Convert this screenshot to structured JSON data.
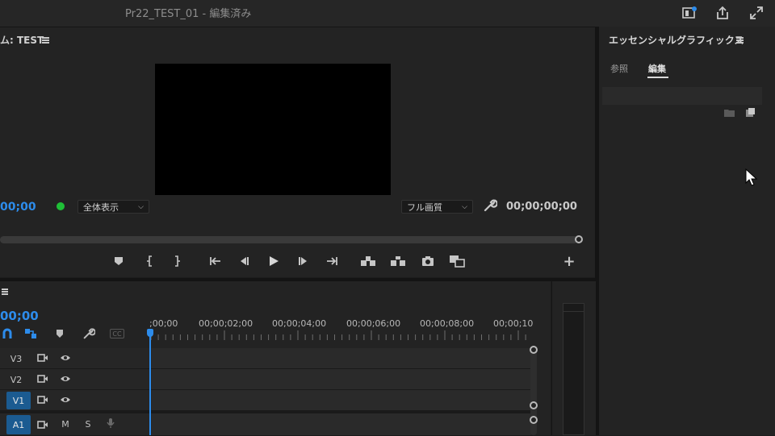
{
  "window": {
    "title": "Pr22_TEST_01 - 編集済み"
  },
  "top_icons": [
    "quick-export-icon",
    "share-icon",
    "maximize-icon"
  ],
  "program_monitor": {
    "title": "ム: TEST",
    "timecode_current": "00;00",
    "zoom_dropdown": "全体表示",
    "quality_dropdown": "フル画質",
    "timecode_duration": "00;00;00;00",
    "controls": [
      "add-marker",
      "mark-in",
      "mark-out",
      "go-to-in",
      "step-back",
      "play",
      "step-forward",
      "go-to-out",
      "lift",
      "extract",
      "export-frame",
      "comparison-view",
      "add-button"
    ],
    "status_color": "#1fbf37"
  },
  "timeline": {
    "timecode": "00;00",
    "ruler_labels": [
      ";00;00",
      "00;00;02;00",
      "00;00;04;00",
      "00;00;06;00",
      "00;00;08;00",
      "00;00;10"
    ],
    "tracks": [
      {
        "name": "V3",
        "active": false,
        "kind": "video"
      },
      {
        "name": "V2",
        "active": false,
        "kind": "video"
      },
      {
        "name": "V1",
        "active": true,
        "kind": "video"
      },
      {
        "name": "A1",
        "active": true,
        "kind": "audio",
        "mute": "M",
        "solo": "S"
      }
    ],
    "tools_label_cc": "CC",
    "accent_color": "#2d8ceb"
  },
  "essential_graphics": {
    "title": "エッセンシャルグラフィックス",
    "tabs": [
      {
        "label": "参照",
        "selected": false
      },
      {
        "label": "編集",
        "selected": true
      }
    ]
  }
}
